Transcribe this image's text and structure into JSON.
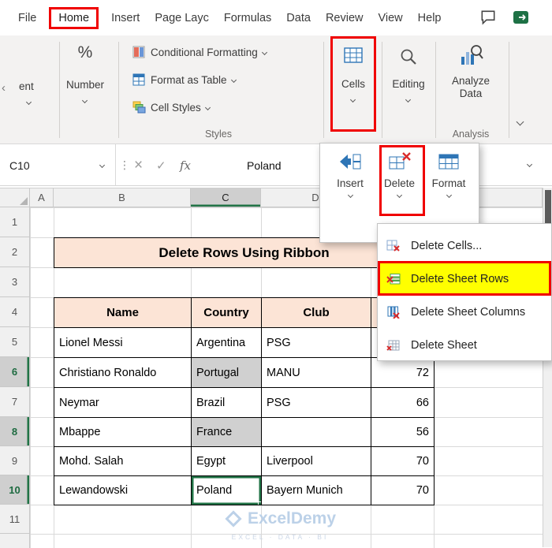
{
  "titlebar": {
    "tabs": [
      {
        "label": "File"
      },
      {
        "label": "Home"
      },
      {
        "label": "Insert"
      },
      {
        "label": "Page Layc"
      },
      {
        "label": "Formulas"
      },
      {
        "label": "Data"
      },
      {
        "label": "Review"
      },
      {
        "label": "View"
      },
      {
        "label": "Help"
      }
    ]
  },
  "ribbon": {
    "alignment_partial": "ent",
    "percent_symbol": "%",
    "number_label": "Number",
    "styles_items": [
      "Conditional Formatting",
      "Format as Table",
      "Cell Styles"
    ],
    "styles_group_label": "Styles",
    "cells_label": "Cells",
    "editing_label": "Editing",
    "analyze_label": "Analyze Data",
    "analysis_group_label": "Analysis"
  },
  "formula_bar": {
    "name_box": "C10",
    "fx_label": "fx",
    "value": "Poland"
  },
  "icons": {
    "cancel": "×",
    "enter": "✓",
    "more": "⋮"
  },
  "cells_menu": {
    "items": [
      {
        "label": "Insert"
      },
      {
        "label": "Delete"
      },
      {
        "label": "Format"
      }
    ]
  },
  "delete_menu": {
    "items": [
      {
        "label": "Delete Cells..."
      },
      {
        "label": "Delete Sheet Rows"
      },
      {
        "label": "Delete Sheet Columns"
      },
      {
        "label": "Delete Sheet"
      }
    ]
  },
  "sheet": {
    "column_headers": [
      "A",
      "B",
      "C",
      "D"
    ],
    "row_headers": [
      "1",
      "2",
      "3",
      "4",
      "5",
      "6",
      "7",
      "8",
      "9",
      "10",
      "11"
    ],
    "title": "Delete Rows Using Ribbon",
    "table_headers": {
      "name": "Name",
      "country": "Country",
      "club": "Club"
    },
    "rows": [
      {
        "name": "Lionel Messi",
        "country": "Argentina",
        "club": "PSG",
        "value": ""
      },
      {
        "name": "Christiano Ronaldo",
        "country": "Portugal",
        "club": "MANU",
        "value": "72"
      },
      {
        "name": "Neymar",
        "country": "Brazil",
        "club": "PSG",
        "value": "66"
      },
      {
        "name": "Mbappe",
        "country": "France",
        "club": "",
        "value": "56"
      },
      {
        "name": "Mohd. Salah",
        "country": "Egypt",
        "club": "Liverpool",
        "value": "70"
      },
      {
        "name": "Lewandowski",
        "country": "Poland",
        "club": "Bayern Munich",
        "value": "70"
      }
    ]
  },
  "watermark": {
    "brand": "ExcelDemy",
    "tagline": "EXCEL · DATA · BI"
  },
  "colors": {
    "accent_green": "#217346",
    "highlight_yellow": "#ffff00",
    "annotation_red": "#f00000",
    "header_fill": "#fce4d6",
    "selected_fill": "#d0d0d0"
  }
}
